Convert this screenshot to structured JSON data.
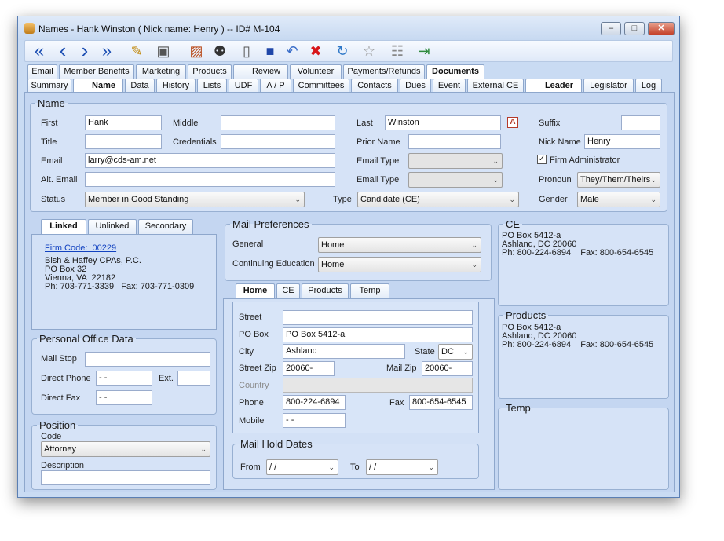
{
  "window": {
    "title": "Names - Hank Winston  ( Nick name: Henry )  -- ID# M-104",
    "minimize": "–",
    "restore": "□",
    "close": "✕"
  },
  "toolbar": {
    "icons": [
      "first-record-icon",
      "previous-record-icon",
      "next-record-icon",
      "last-record-icon",
      "folder-icon",
      "camera-icon",
      "card-icon",
      "binoculars-icon",
      "new-page-icon",
      "save-icon",
      "undo-icon",
      "delete-icon",
      "refresh-icon",
      "star-icon",
      "gift-icon",
      "exit-icon"
    ],
    "first": "«",
    "prev": "‹",
    "next": "›",
    "last": "»",
    "folder": "✎",
    "camera": "▣",
    "card": "▨",
    "binoculars": "⚉",
    "newpage": "▯",
    "save": "■",
    "undo": "↶",
    "delete": "✖",
    "refresh": "↻",
    "star": "☆",
    "gift": "☷",
    "exit": "⇥",
    "delete_color": "#d8161a"
  },
  "tabs_row1": [
    "Email",
    "Member Benefits",
    "Marketing",
    "Products",
    "Review",
    "Volunteer",
    "Payments/Refunds",
    "Documents"
  ],
  "tabs_row2": [
    "Summary",
    "Name",
    "Data",
    "History",
    "Lists",
    "UDF",
    "A / P",
    "Committees",
    "Contacts",
    "Dues",
    "Event",
    "External CE",
    "Leader",
    "Legislator",
    "Log"
  ],
  "name_section": {
    "legend": "Name",
    "first_label": "First",
    "first": "Hank",
    "middle_label": "Middle",
    "middle": "",
    "last_label": "Last",
    "last": "Winston",
    "suffix_label": "Suffix",
    "suffix": "",
    "title_label": "Title",
    "title": "",
    "credentials_label": "Credentials",
    "credentials": "",
    "prior_label": "Prior Name",
    "prior": "",
    "nick_label": "Nick Name",
    "nick": "Henry",
    "email_label": "Email",
    "email": "larry@cds-am.net",
    "email_type_label": "Email Type",
    "email_type": "",
    "firm_admin_label": "Firm Administrator",
    "firm_admin_checked": "✓",
    "alt_email_label": "Alt. Email",
    "alt_email": "",
    "email_type2_label": "Email Type",
    "email_type2": "",
    "pronoun_label": "Pronoun",
    "pronoun": "They/Them/Theirs",
    "status_label": "Status",
    "status": "Member in Good Standing",
    "type_label": "Type",
    "type": "Candidate (CE)",
    "gender_label": "Gender",
    "gender": "Male",
    "a_button": "A"
  },
  "linked": {
    "tabs": [
      "Linked",
      "Unlinked",
      "Secondary"
    ],
    "firm_code": "Firm Code:  00229",
    "address": "Bish & Haffey CPAs, P.C.\nPO Box 32\nVienna, VA  22182\nPh: 703-771-3339   Fax: 703-771-0309"
  },
  "mail_prefs": {
    "legend": "Mail Preferences",
    "general_label": "General",
    "general": "Home",
    "ce_label": "Continuing Education",
    "ce": "Home"
  },
  "ce_box": {
    "legend": "CE",
    "address": "PO Box 5412-a\nAshland, DC 20060\nPh: 800-224-6894    Fax: 800-654-6545"
  },
  "products_box": {
    "legend": "Products",
    "address": "PO Box 5412-a\nAshland, DC 20060\nPh: 800-224-6894    Fax: 800-654-6545"
  },
  "temp_box": {
    "legend": "Temp"
  },
  "office": {
    "legend": "Personal Office Data",
    "mailstop_label": "Mail Stop",
    "mailstop": "",
    "phone_label": "Direct Phone",
    "phone": "  -  -",
    "ext_label": "Ext.",
    "ext": "",
    "fax_label": "Direct Fax",
    "fax": "  -  -"
  },
  "position": {
    "legend": "Position",
    "code_label": "Code",
    "code": "Attorney",
    "desc_label": "Description",
    "desc": ""
  },
  "address_tabs": [
    "Home",
    "CE",
    "Products",
    "Temp"
  ],
  "address": {
    "street_label": "Street",
    "street": "",
    "pobox_label": "PO Box",
    "pobox": "PO Box 5412-a",
    "city_label": "City",
    "city": "Ashland",
    "state_label": "State",
    "state": "DC",
    "zip_label": "Street Zip",
    "zip": "20060-",
    "mailzip_label": "Mail Zip",
    "mailzip": "20060-",
    "country_label": "Country",
    "country": "",
    "phone_label": "Phone",
    "phone": "800-224-6894",
    "fax_label": "Fax",
    "fax": "800-654-6545",
    "mobile_label": "Mobile",
    "mobile": "  -  -"
  },
  "hold": {
    "legend": "Mail Hold Dates",
    "from_label": "From",
    "from": "  /   /",
    "to_label": "To",
    "to": "  /   /"
  }
}
